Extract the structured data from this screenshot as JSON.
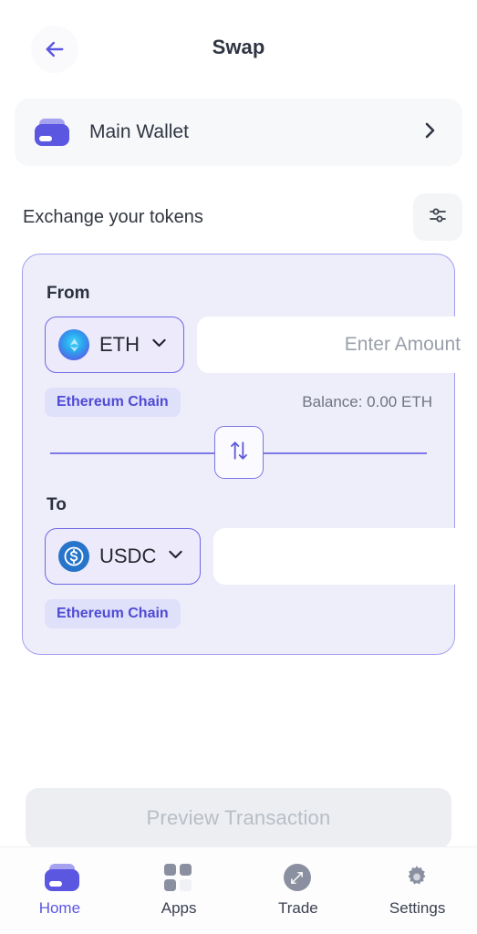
{
  "header": {
    "title": "Swap",
    "back_icon": "arrow-left-icon"
  },
  "wallet": {
    "name": "Main Wallet",
    "icon": "wallet-icon",
    "chevron_icon": "chevron-right-icon"
  },
  "section": {
    "title": "Exchange your tokens",
    "settings_icon": "sliders-icon"
  },
  "swap": {
    "from": {
      "label": "From",
      "token_symbol": "ETH",
      "token_icon": "eth-coin-icon",
      "dropdown_icon": "chevron-down-icon",
      "amount_value": "",
      "amount_placeholder": "Enter Amount",
      "chain": "Ethereum Chain",
      "balance": "Balance: 0.00 ETH"
    },
    "toggle": {
      "icon": "swap-vertical-arrows-icon"
    },
    "to": {
      "label": "To",
      "token_symbol": "USDC",
      "token_icon": "usdc-coin-icon",
      "dropdown_icon": "chevron-down-icon",
      "amount_value": "",
      "amount_placeholder": "",
      "chain": "Ethereum Chain"
    }
  },
  "preview": {
    "label": "Preview Transaction",
    "disabled": true
  },
  "nav": {
    "items": [
      {
        "label": "Home",
        "icon": "wallet-icon",
        "active": true
      },
      {
        "label": "Apps",
        "icon": "grid-icon",
        "active": false
      },
      {
        "label": "Trade",
        "icon": "expand-arrows-icon",
        "active": false
      },
      {
        "label": "Settings",
        "icon": "gear-icon",
        "active": false
      }
    ]
  },
  "colors": {
    "accent": "#5b57e0",
    "card_bg": "#eeeefb",
    "card_border": "#a49ef0",
    "chain_pill_bg": "#dfe0fa",
    "chain_pill_text": "#4f4bd4",
    "eth_blue": "#2aa7ef",
    "usdc_blue": "#2775ca",
    "muted_text": "#6f7480",
    "nav_inactive": "#8b90a0"
  }
}
